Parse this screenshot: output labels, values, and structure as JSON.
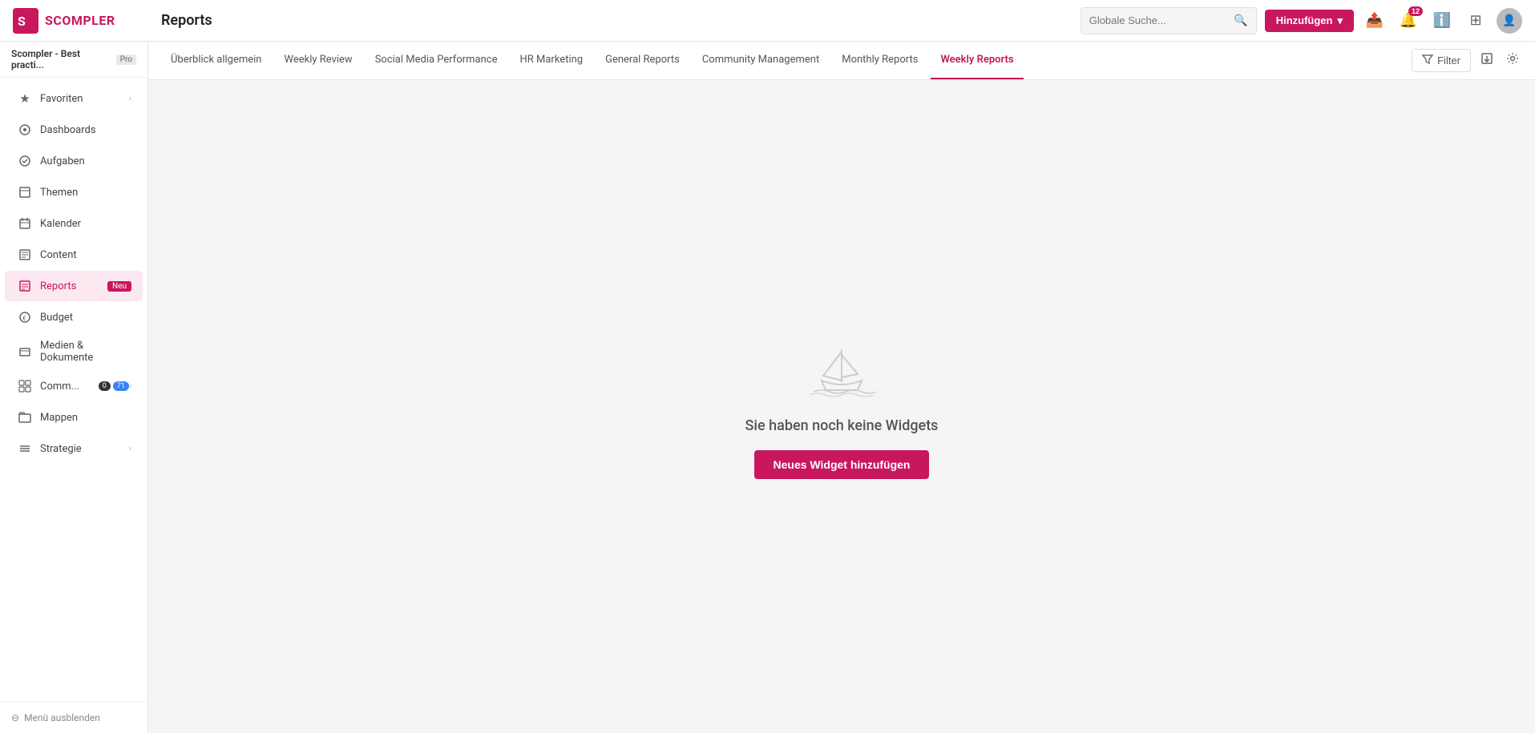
{
  "app": {
    "logo_text": "SCOMPLER",
    "title": "Reports"
  },
  "workspace": {
    "name": "Scompler - Best practi...",
    "plan": "Pro"
  },
  "header": {
    "search_placeholder": "Globale Suche...",
    "add_button_label": "Hinzufügen",
    "notification_count": "12"
  },
  "sidebar": {
    "items": [
      {
        "id": "favoriten",
        "label": "Favoriten",
        "icon": "★",
        "has_arrow": true,
        "active": false
      },
      {
        "id": "dashboards",
        "label": "Dashboards",
        "icon": "◎",
        "has_arrow": false,
        "active": false
      },
      {
        "id": "aufgaben",
        "label": "Aufgaben",
        "icon": "◑",
        "has_arrow": false,
        "active": false
      },
      {
        "id": "themen",
        "label": "Themen",
        "icon": "▣",
        "has_arrow": false,
        "active": false
      },
      {
        "id": "kalender",
        "label": "Kalender",
        "icon": "◫",
        "has_arrow": false,
        "active": false
      },
      {
        "id": "content",
        "label": "Content",
        "icon": "▦",
        "has_arrow": false,
        "active": false
      },
      {
        "id": "reports",
        "label": "Reports",
        "icon": "▤",
        "badge_new": "Neu",
        "has_arrow": false,
        "active": true
      },
      {
        "id": "budget",
        "label": "Budget",
        "icon": "◈",
        "has_arrow": false,
        "active": false
      },
      {
        "id": "medien",
        "label": "Medien & Dokumente",
        "icon": "▧",
        "has_arrow": false,
        "active": false
      },
      {
        "id": "comm",
        "label": "Comm...",
        "icon": "⊞",
        "badge_count": "0",
        "badge_count_blue": "71",
        "has_arrow": true,
        "active": false
      },
      {
        "id": "mappen",
        "label": "Mappen",
        "icon": "▭",
        "has_arrow": false,
        "active": false
      },
      {
        "id": "strategie",
        "label": "Strategie",
        "icon": "≡",
        "has_arrow": true,
        "active": false
      }
    ],
    "footer": {
      "menu_toggle_label": "Menü ausblenden"
    }
  },
  "subnav": {
    "tabs": [
      {
        "id": "ueberblick",
        "label": "Überblick allgemein",
        "active": false
      },
      {
        "id": "weekly-review",
        "label": "Weekly Review",
        "active": false
      },
      {
        "id": "social-media",
        "label": "Social Media Performance",
        "active": false
      },
      {
        "id": "hr-marketing",
        "label": "HR Marketing",
        "active": false
      },
      {
        "id": "general-reports",
        "label": "General Reports",
        "active": false
      },
      {
        "id": "community-management",
        "label": "Community Management",
        "active": false
      },
      {
        "id": "monthly-reports",
        "label": "Monthly Reports",
        "active": false
      },
      {
        "id": "weekly-reports",
        "label": "Weekly Reports",
        "active": true
      }
    ],
    "filter_label": "Filter"
  },
  "empty_state": {
    "message": "Sie haben noch keine Widgets",
    "button_label": "Neues Widget hinzufügen"
  }
}
